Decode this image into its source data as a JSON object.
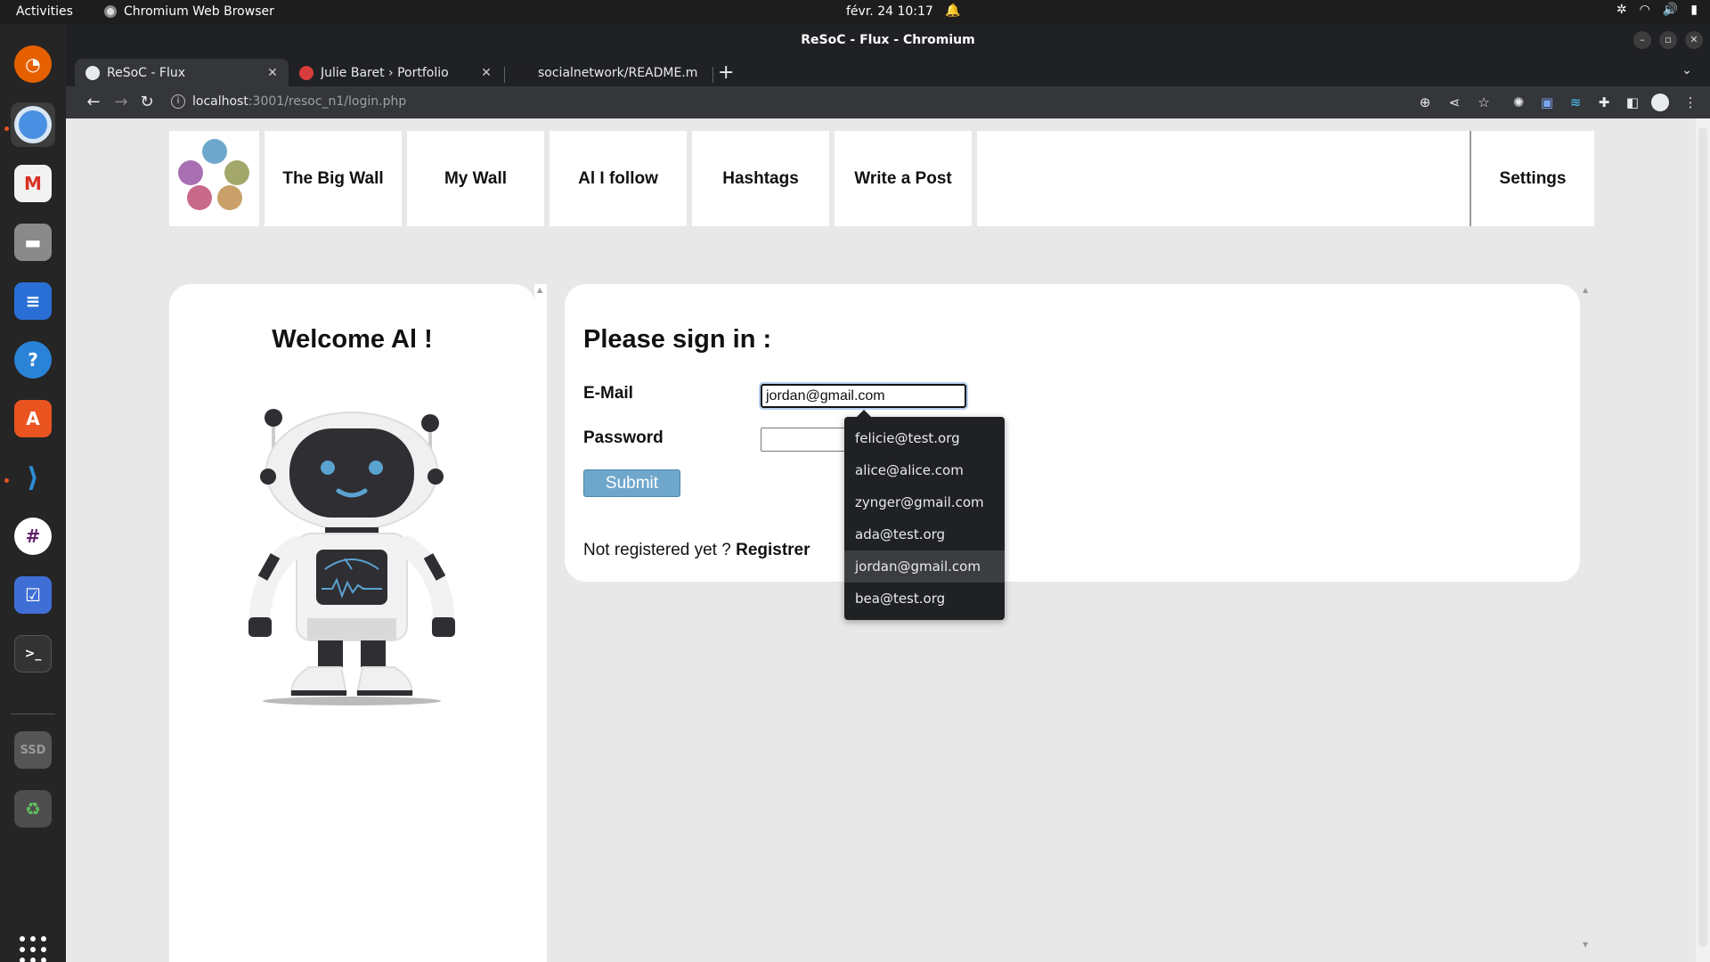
{
  "system": {
    "activities": "Activities",
    "app_name": "Chromium Web Browser",
    "clock": "févr. 24  10:17"
  },
  "browser": {
    "window_title": "ReSoC - Flux - Chromium",
    "tabs": [
      {
        "label": "ReSoC - Flux",
        "active": true
      },
      {
        "label": "Julie Baret › Portfolio",
        "active": false
      },
      {
        "label": "socialnetwork/README.m",
        "active": false
      }
    ],
    "url_host": "localhost",
    "url_path": ":3001/resoc_n1/login.php"
  },
  "page": {
    "nav": {
      "items": [
        "The Big Wall",
        "My Wall",
        "Al I follow",
        "Hashtags",
        "Write a Post"
      ],
      "settings": "Settings"
    },
    "welcome": "Welcome Al !",
    "signin_title": "Please sign in :",
    "email_label": "E-Mail",
    "email_value": "jordan@gmail.com",
    "password_label": "Password",
    "submit_label": "Submit",
    "not_registered": "Not registered yet ?",
    "register_link": "Registrer",
    "autocomplete": {
      "options": [
        "felicie@test.org",
        "alice@alice.com",
        "zynger@gmail.com",
        "ada@test.org",
        "jordan@gmail.com",
        "bea@test.org"
      ],
      "selected": "jordan@gmail.com"
    }
  },
  "colors": {
    "logo_dots": [
      "#6fa7cc",
      "#a86fb3",
      "#a3a86a",
      "#c9698a",
      "#c9a06a"
    ],
    "submit": "#6fa7cc"
  }
}
